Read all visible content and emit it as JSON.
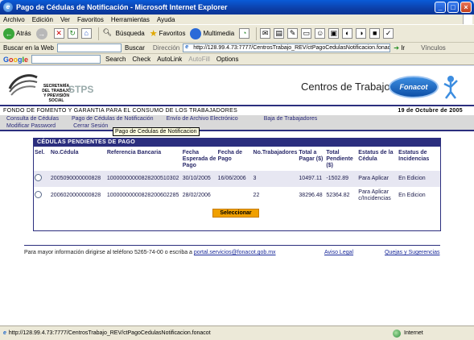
{
  "window": {
    "title": "Pago de Cédulas de Notificación - Microsoft Internet Explorer"
  },
  "menu": [
    "Archivo",
    "Edición",
    "Ver",
    "Favoritos",
    "Herramientas",
    "Ayuda"
  ],
  "toolbar": {
    "back": "Atrás",
    "search": "Búsqueda",
    "favorites": "Favoritos",
    "multimedia": "Multimedia"
  },
  "searchbar": {
    "label": "Buscar en la Web",
    "buscar": "Buscar",
    "direccion": "Dirección",
    "url": "http://128.99.4.73:7777/CentrosTrabajo_REV/ctPagoCedulasNotificacion.fonacot",
    "go": "Ir",
    "vinculos": "Vínculos"
  },
  "googlebar": {
    "search": "Search",
    "check": "Check",
    "autolink": "AutoLink",
    "autofill": "AutoFill",
    "options": "Options"
  },
  "header": {
    "stps_text": "SECRETARÍA DEL TRABAJO Y PREVISIÓN SOCIAL",
    "stps_big": "STPS",
    "site_title": "Centros de Trabajo",
    "fonacot_logo": "Fonacot",
    "fondo": "FONDO DE FOMENTO Y GARANTIA PARA EL CONSUMO DE LOS TRABAJADORES",
    "date": "19 de Octubre de 2005"
  },
  "nav": {
    "row1": [
      "Consulta de Cédulas",
      "Pago de Cédulas de Notificación",
      "Envío de Archivo Electrónico",
      "Baja de Trabajadores"
    ],
    "row2": [
      "Modificar Password",
      "Cerrar Sesión"
    ],
    "tooltip": "Pago de Cedulas de Notificacion"
  },
  "panel": {
    "title": "CÉDULAS PENDIENTES DE PAGO",
    "headers": [
      "Sel.",
      "No.Cédula",
      "Referencia Bancaria",
      "Fecha Esperada de Pago",
      "Fecha de Pago",
      "No.Trabajadores",
      "Total a Pagar ($)",
      "Total Pendiente ($)",
      "Estatus de la Cédula",
      "Estatus de Incidencias"
    ],
    "rows": [
      {
        "cedula": "2005090000000828",
        "referencia": "10000000000828200510302",
        "esperada": "30/10/2005",
        "pago": "16/06/2006",
        "trabajadores": "3",
        "total": "10497.11",
        "pendiente": "-1502.89",
        "estatus": "Para Aplicar",
        "incidencias": "En Edicion"
      },
      {
        "cedula": "2006020000000828",
        "referencia": "10000000000828200602285",
        "esperada": "28/02/2006",
        "pago": "",
        "trabajadores": "22",
        "total": "38296.48",
        "pendiente": "52364.82",
        "estatus": "Para Aplicar c/Incidencias",
        "incidencias": "En Edicion"
      }
    ],
    "button": "Seleccionar"
  },
  "footer": {
    "text": "Para mayor información dirigirse al teléfono 5265-74-00 o escriba a",
    "email": "portal.servicios@fonacot.gob.mx",
    "aviso": "Aviso Legal",
    "quejas": "Quejas y Sugerencias"
  },
  "status": {
    "url": "http://128.99.4.73:7777/CentrosTrabajo_REV/ctPagoCedulasNotificacion.fonacot",
    "zone": "Internet"
  }
}
